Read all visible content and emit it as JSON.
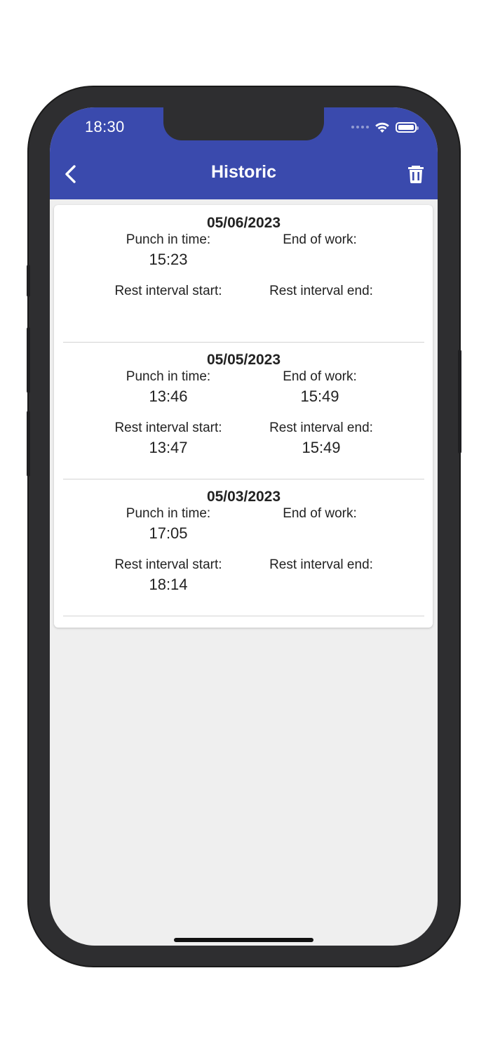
{
  "status_bar": {
    "time": "18:30"
  },
  "app_bar": {
    "title": "Historic"
  },
  "icons": {
    "back": "back-arrow-icon",
    "delete": "trash-icon",
    "wifi": "wifi-icon",
    "battery": "battery-icon"
  },
  "colors": {
    "app_bar": "#3a4aad",
    "background": "#efefef",
    "card": "#ffffff"
  },
  "labels": {
    "punch_in": "Punch in time:",
    "end_of_work": "End of work:",
    "rest_start": "Rest interval start:",
    "rest_end": "Rest interval end:"
  },
  "entries": [
    {
      "date": "05/06/2023",
      "punch_in": "15:23",
      "end_of_work": "",
      "rest_start": "",
      "rest_end": ""
    },
    {
      "date": "05/05/2023",
      "punch_in": "13:46",
      "end_of_work": "15:49",
      "rest_start": "13:47",
      "rest_end": "15:49"
    },
    {
      "date": "05/03/2023",
      "punch_in": "17:05",
      "end_of_work": "",
      "rest_start": "18:14",
      "rest_end": ""
    }
  ]
}
